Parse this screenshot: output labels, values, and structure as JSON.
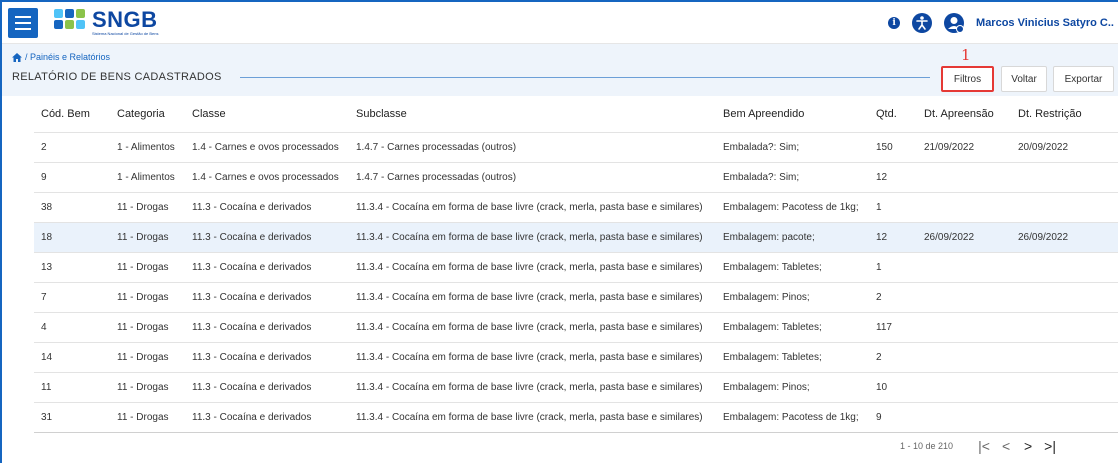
{
  "app": {
    "logo_title": "SNGB",
    "logo_subtitle": "Sistema Nacional de Gestão de Bens",
    "user_name": "Marcos Vinicius Satyro C..",
    "info_label": "i"
  },
  "breadcrumb": {
    "text": "/ Painéis e Relatórios"
  },
  "page": {
    "title": "RELATÓRIO DE BENS CADASTRADOS",
    "annotation": "1"
  },
  "toolbar": {
    "filtros": "Filtros",
    "voltar": "Voltar",
    "exportar": "Exportar"
  },
  "table": {
    "headers": [
      "Cód. Bem",
      "Categoria",
      "Classe",
      "Subclasse",
      "Bem Apreendido",
      "Qtd.",
      "Dt. Apreensão",
      "Dt. Restrição"
    ],
    "rows": [
      [
        "2",
        "1 - Alimentos",
        "1.4 - Carnes e ovos processados",
        "1.4.7 - Carnes processadas (outros)",
        "Embalada?: Sim;",
        "150",
        "21/09/2022",
        "20/09/2022"
      ],
      [
        "9",
        "1 - Alimentos",
        "1.4 - Carnes e ovos processados",
        "1.4.7 - Carnes processadas (outros)",
        "Embalada?: Sim;",
        "12",
        "",
        ""
      ],
      [
        "38",
        "11 - Drogas",
        "11.3 - Cocaína e derivados",
        "11.3.4 - Cocaína em forma de base livre (crack, merla, pasta base e similares)",
        "Embalagem: Pacotess de 1kg;",
        "1",
        "",
        ""
      ],
      [
        "18",
        "11 - Drogas",
        "11.3 - Cocaína e derivados",
        "11.3.4 - Cocaína em forma de base livre (crack, merla, pasta base e similares)",
        "Embalagem: pacote;",
        "12",
        "26/09/2022",
        "26/09/2022"
      ],
      [
        "13",
        "11 - Drogas",
        "11.3 - Cocaína e derivados",
        "11.3.4 - Cocaína em forma de base livre (crack, merla, pasta base e similares)",
        "Embalagem: Tabletes;",
        "1",
        "",
        ""
      ],
      [
        "7",
        "11 - Drogas",
        "11.3 - Cocaína e derivados",
        "11.3.4 - Cocaína em forma de base livre (crack, merla, pasta base e similares)",
        "Embalagem: Pinos;",
        "2",
        "",
        ""
      ],
      [
        "4",
        "11 - Drogas",
        "11.3 - Cocaína e derivados",
        "11.3.4 - Cocaína em forma de base livre (crack, merla, pasta base e similares)",
        "Embalagem: Tabletes;",
        "117",
        "",
        ""
      ],
      [
        "14",
        "11 - Drogas",
        "11.3 - Cocaína e derivados",
        "11.3.4 - Cocaína em forma de base livre (crack, merla, pasta base e similares)",
        "Embalagem: Tabletes;",
        "2",
        "",
        ""
      ],
      [
        "11",
        "11 - Drogas",
        "11.3 - Cocaína e derivados",
        "11.3.4 - Cocaína em forma de base livre (crack, merla, pasta base e similares)",
        "Embalagem: Pinos;",
        "10",
        "",
        ""
      ],
      [
        "31",
        "11 - Drogas",
        "11.3 - Cocaína e derivados",
        "11.3.4 - Cocaína em forma de base livre (crack, merla, pasta base e similares)",
        "Embalagem: Pacotess de 1kg;",
        "9",
        "",
        ""
      ]
    ]
  },
  "pagination": {
    "range": "1 - 10 de 210",
    "first": "|<",
    "prev": "<",
    "next": ">",
    "last": ">|"
  },
  "colors": {
    "primary": "#1565c0",
    "header_bg": "#eef4fb",
    "highlight_row": "#eaf2fb",
    "annotation_red": "#e53935"
  }
}
